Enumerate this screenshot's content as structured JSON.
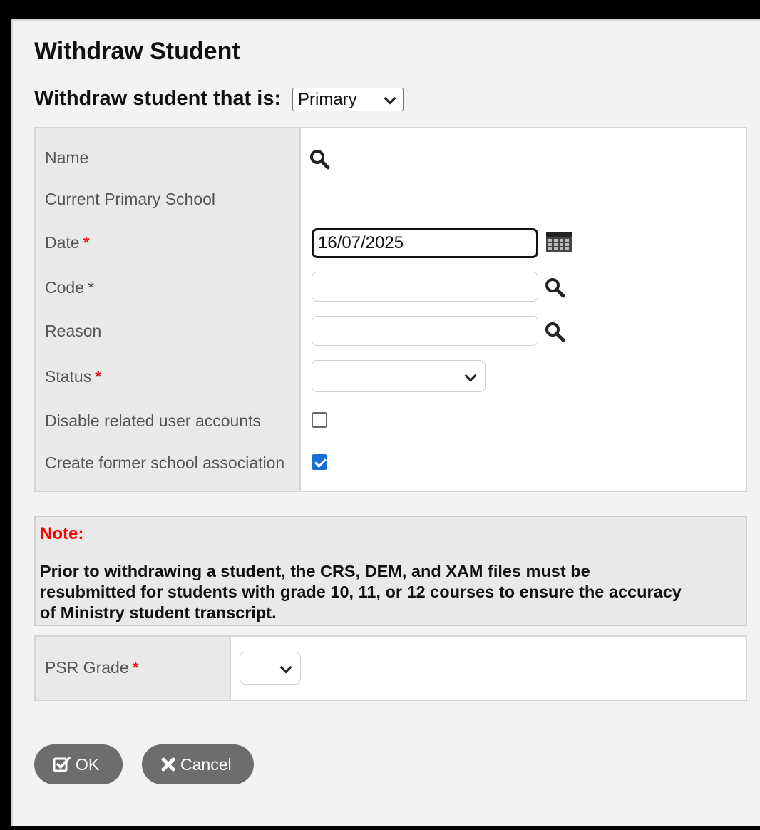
{
  "dialog": {
    "title": "Withdraw Student",
    "withdraw_prompt": "Withdraw student that is:",
    "withdraw_type": {
      "selected": "Primary"
    }
  },
  "form": {
    "name_label": "Name",
    "school_label": "Current Primary School",
    "date_label": "Date",
    "date_value": "16/07/2025",
    "code_label": "Code",
    "reason_label": "Reason",
    "status_label": "Status",
    "disable_accounts_label": "Disable related user accounts",
    "disable_accounts_checked": false,
    "former_assoc_label": "Create former school association",
    "former_assoc_checked": true,
    "required_marker": "*"
  },
  "note": {
    "title": "Note:",
    "text": "Prior to withdrawing a student, the CRS, DEM, and XAM files must be resubmitted for students with grade 10, 11, or 12 courses to ensure the accuracy of Ministry student transcript."
  },
  "psr": {
    "label": "PSR Grade"
  },
  "buttons": {
    "ok_label": "OK",
    "cancel_label": "Cancel"
  },
  "colors": {
    "required": "#e31b1b",
    "note_title": "#ff0000",
    "button_bg": "#6d6d6d",
    "checkbox_checked": "#1a6fd6"
  },
  "icons": [
    "search-icon",
    "calendar-icon",
    "check-square-icon",
    "close-x-icon",
    "chevron-down-icon"
  ]
}
